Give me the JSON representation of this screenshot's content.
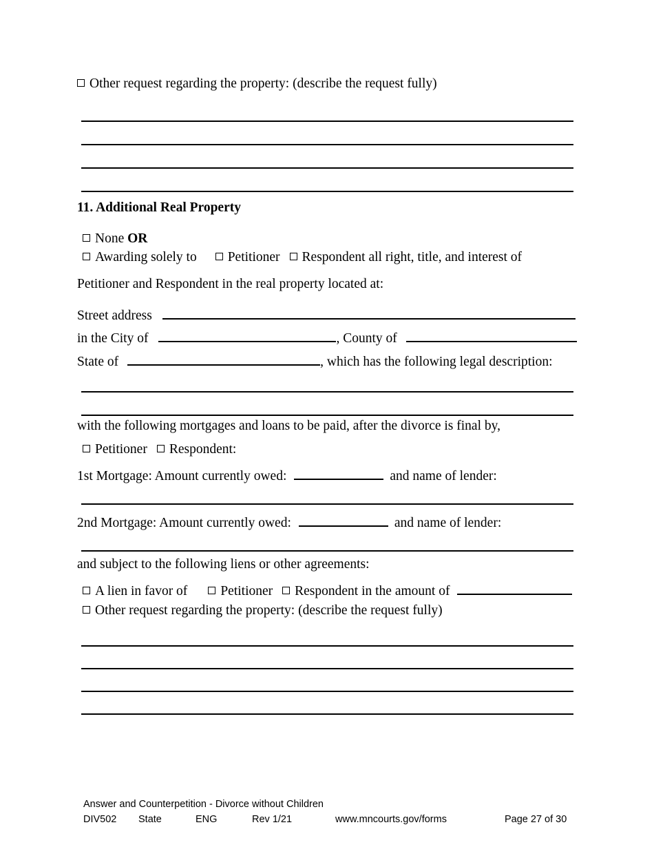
{
  "document": {
    "form_id": "DIV502",
    "title": "Answer and Counterpetition - Divorce without Children"
  },
  "top_block": {
    "other_request_label": "Other request regarding the property: (describe the request fully)"
  },
  "section": {
    "heading": "11. Additional Real Property",
    "none_label": "None",
    "or_label": "OR",
    "awarding_label": "Awarding solely to",
    "petitioner_label": "Petitioner",
    "respondent_all_rights_label": "Respondent all right, title, and interest of",
    "parties_line": "Petitioner and Respondent in the real property located at:",
    "street_address_label": "Street address",
    "city_label": "in the City of",
    "county_label": ", County of",
    "state_label": "State of",
    "legal_description_label": ", which has the following legal description:",
    "mortgages_intro": "with the following mortgages and loans to be paid, after the divorce is final by,",
    "payer_petitioner_label": "Petitioner",
    "payer_respondent_label": "Respondent:",
    "first_mortgage_label": "1st Mortgage: Amount currently owed:",
    "second_mortgage_label": "2nd Mortgage: Amount currently owed:",
    "lender_label": "and name of lender:",
    "liens_intro": "and subject to the following liens or other agreements:",
    "lien_favor_label": "A lien in favor of",
    "lien_petitioner_label": "Petitioner",
    "lien_respondent_label": "Respondent in the amount of",
    "other_request_label": "Other request regarding the property: (describe the request fully)"
  },
  "footer": {
    "title": "Answer and Counterpetition - Divorce without Children",
    "form_number": "DIV502",
    "scope": "State",
    "language": "ENG",
    "revision": "Rev 1/21",
    "website": "www.mncourts.gov/forms",
    "page": "Page 27 of 30"
  }
}
